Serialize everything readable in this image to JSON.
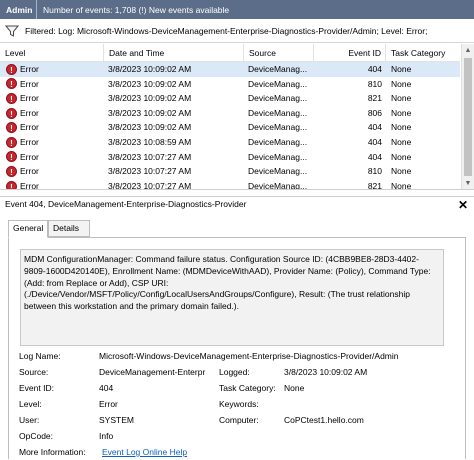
{
  "titlebar": {
    "app": "Admin",
    "info": "Number of events: 1,708 (!) New events available"
  },
  "filter": {
    "icon": "funnel-icon",
    "text": "Filtered: Log: Microsoft-Windows-DeviceManagement-Enterprise-Diagnostics-Provider/Admin; Level: Error;"
  },
  "table": {
    "columns": [
      "Level",
      "Date and Time",
      "Source",
      "Event ID",
      "Task Category"
    ],
    "rows": [
      {
        "level": "Error",
        "date": "3/8/2023 10:09:02 AM",
        "source": "DeviceManag...",
        "id": "404",
        "task": "None"
      },
      {
        "level": "Error",
        "date": "3/8/2023 10:09:02 AM",
        "source": "DeviceManag...",
        "id": "810",
        "task": "None"
      },
      {
        "level": "Error",
        "date": "3/8/2023 10:09:02 AM",
        "source": "DeviceManag...",
        "id": "821",
        "task": "None"
      },
      {
        "level": "Error",
        "date": "3/8/2023 10:09:02 AM",
        "source": "DeviceManag...",
        "id": "806",
        "task": "None"
      },
      {
        "level": "Error",
        "date": "3/8/2023 10:09:02 AM",
        "source": "DeviceManag...",
        "id": "404",
        "task": "None"
      },
      {
        "level": "Error",
        "date": "3/8/2023 10:08:59 AM",
        "source": "DeviceManag...",
        "id": "404",
        "task": "None"
      },
      {
        "level": "Error",
        "date": "3/8/2023 10:07:27 AM",
        "source": "DeviceManag...",
        "id": "404",
        "task": "None"
      },
      {
        "level": "Error",
        "date": "3/8/2023 10:07:27 AM",
        "source": "DeviceManag...",
        "id": "810",
        "task": "None"
      },
      {
        "level": "Error",
        "date": "3/8/2023 10:07:27 AM",
        "source": "DeviceManag...",
        "id": "821",
        "task": "None"
      }
    ]
  },
  "detail": {
    "header": "Event 404, DeviceManagement-Enterprise-Diagnostics-Provider",
    "close": "✕",
    "tabs": [
      "General",
      "Details"
    ],
    "message": "MDM ConfigurationManager: Command failure status. Configuration Source ID: (4CBB9BE8-28D3-4402-9809-1600D420140E), Enrollment Name: (MDMDeviceWithAAD), Provider Name: (Policy), Command Type: (Add: from Replace or Add), CSP URI: (./Device/Vendor/MSFT/Policy/Config/LocalUsersAndGroups/Configure), Result: (The trust relationship between this workstation and the primary domain failed.).",
    "labels": {
      "log_name": "Log Name:",
      "source": "Source:",
      "logged": "Logged:",
      "event_id": "Event ID:",
      "task_category": "Task Category:",
      "level": "Level:",
      "keywords": "Keywords:",
      "user": "User:",
      "computer": "Computer:",
      "opcode": "OpCode:",
      "more_info": "More Information:"
    },
    "values": {
      "log_name": "Microsoft-Windows-DeviceManagement-Enterprise-Diagnostics-Provider/Admin",
      "source": "DeviceManagement-Enterpr",
      "logged": "3/8/2023 10:09:02 AM",
      "event_id": "404",
      "task_category": "None",
      "level": "Error",
      "keywords": "",
      "user": "SYSTEM",
      "computer": "CoPCtest1.hello.com",
      "opcode": "Info",
      "more_info_link": "Event Log Online Help"
    }
  }
}
